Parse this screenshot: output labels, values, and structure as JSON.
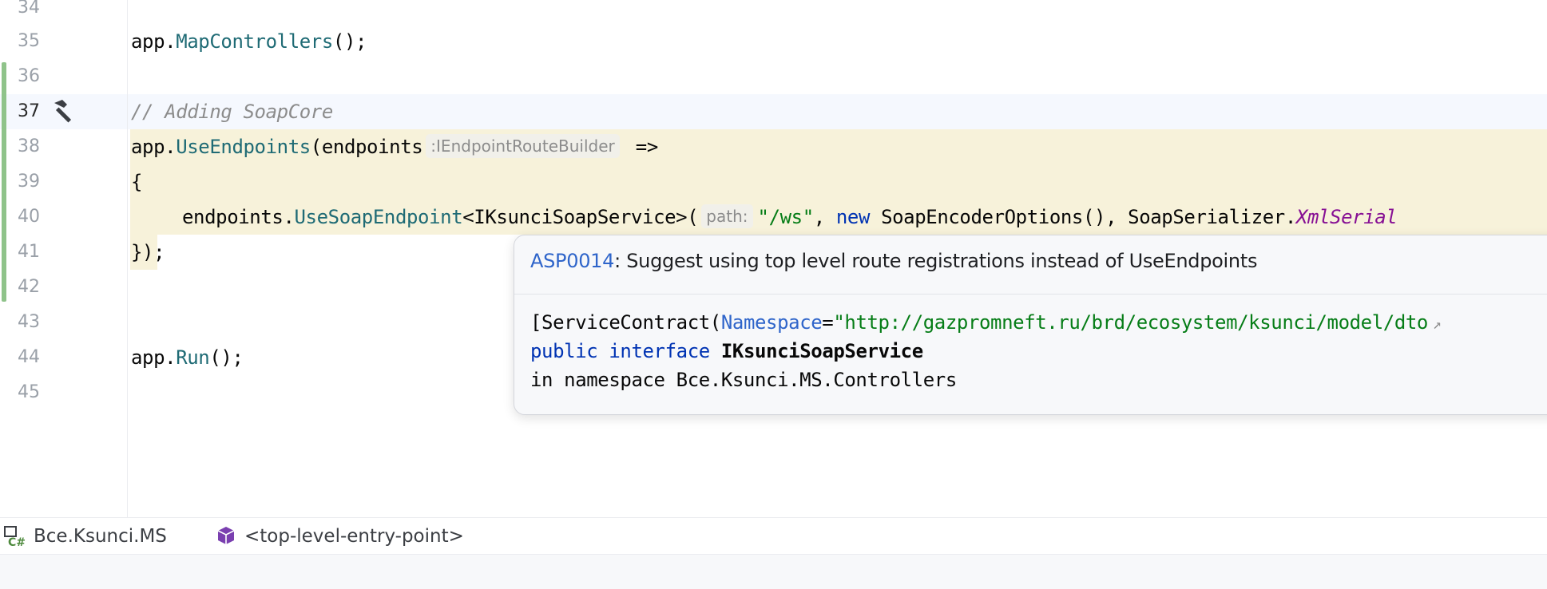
{
  "editor": {
    "lines": [
      {
        "num": "34"
      },
      {
        "num": "35",
        "code": {
          "obj": "app.",
          "method": "MapControllers",
          "rest": "();"
        }
      },
      {
        "num": "36"
      },
      {
        "num": "37",
        "comment": "// Adding SoapCore"
      },
      {
        "num": "38",
        "code": {
          "obj": "app.",
          "method": "UseEndpoints",
          "open": "(endpoints",
          "hint": ":IEndpointRouteBuilder",
          "arrow": " =>"
        }
      },
      {
        "num": "39",
        "code": {
          "text": "{"
        }
      },
      {
        "num": "40",
        "code": {
          "obj": "endpoints.",
          "method": "UseSoapEndpoint",
          "generic": "<IKsunciSoapService>(",
          "hint": "path:",
          "str": "\"/ws\"",
          "comma1": ", ",
          "kw": "new",
          "rest": " SoapEncoderOptions(), SoapSerializer.",
          "static": "XmlSerial"
        }
      },
      {
        "num": "41",
        "code": {
          "text": "});"
        }
      },
      {
        "num": "42"
      },
      {
        "num": "43"
      },
      {
        "num": "44",
        "code": {
          "obj": "app.",
          "method": "Run",
          "rest": "();"
        }
      },
      {
        "num": "45"
      }
    ]
  },
  "popup": {
    "code_link": "ASP0014",
    "message": ": Suggest using top level route registrations instead of UseEndpoints",
    "attr_open": "[ServiceContract(",
    "attr_name": "Namespace",
    "attr_eq": "=",
    "attr_value": "\"http://gazpromneft.ru/brd/ecosystem/ksunci/model/dto",
    "ext_icon": "↗",
    "kw_public": "public",
    "kw_interface": "interface",
    "type_name": "IKsunciSoapService",
    "namespace_line": "in namespace Bce.Ksunci.MS.Controllers"
  },
  "statusbar": {
    "project": "Bce.Ksunci.MS",
    "scope": "<top-level-entry-point>"
  },
  "colors": {
    "method": "#1f6b75",
    "keyword": "#0033b3",
    "string": "#067d17",
    "link": "#2f65ca",
    "highlight": "#f7f2da",
    "vcs_added": "#8fc38a"
  }
}
